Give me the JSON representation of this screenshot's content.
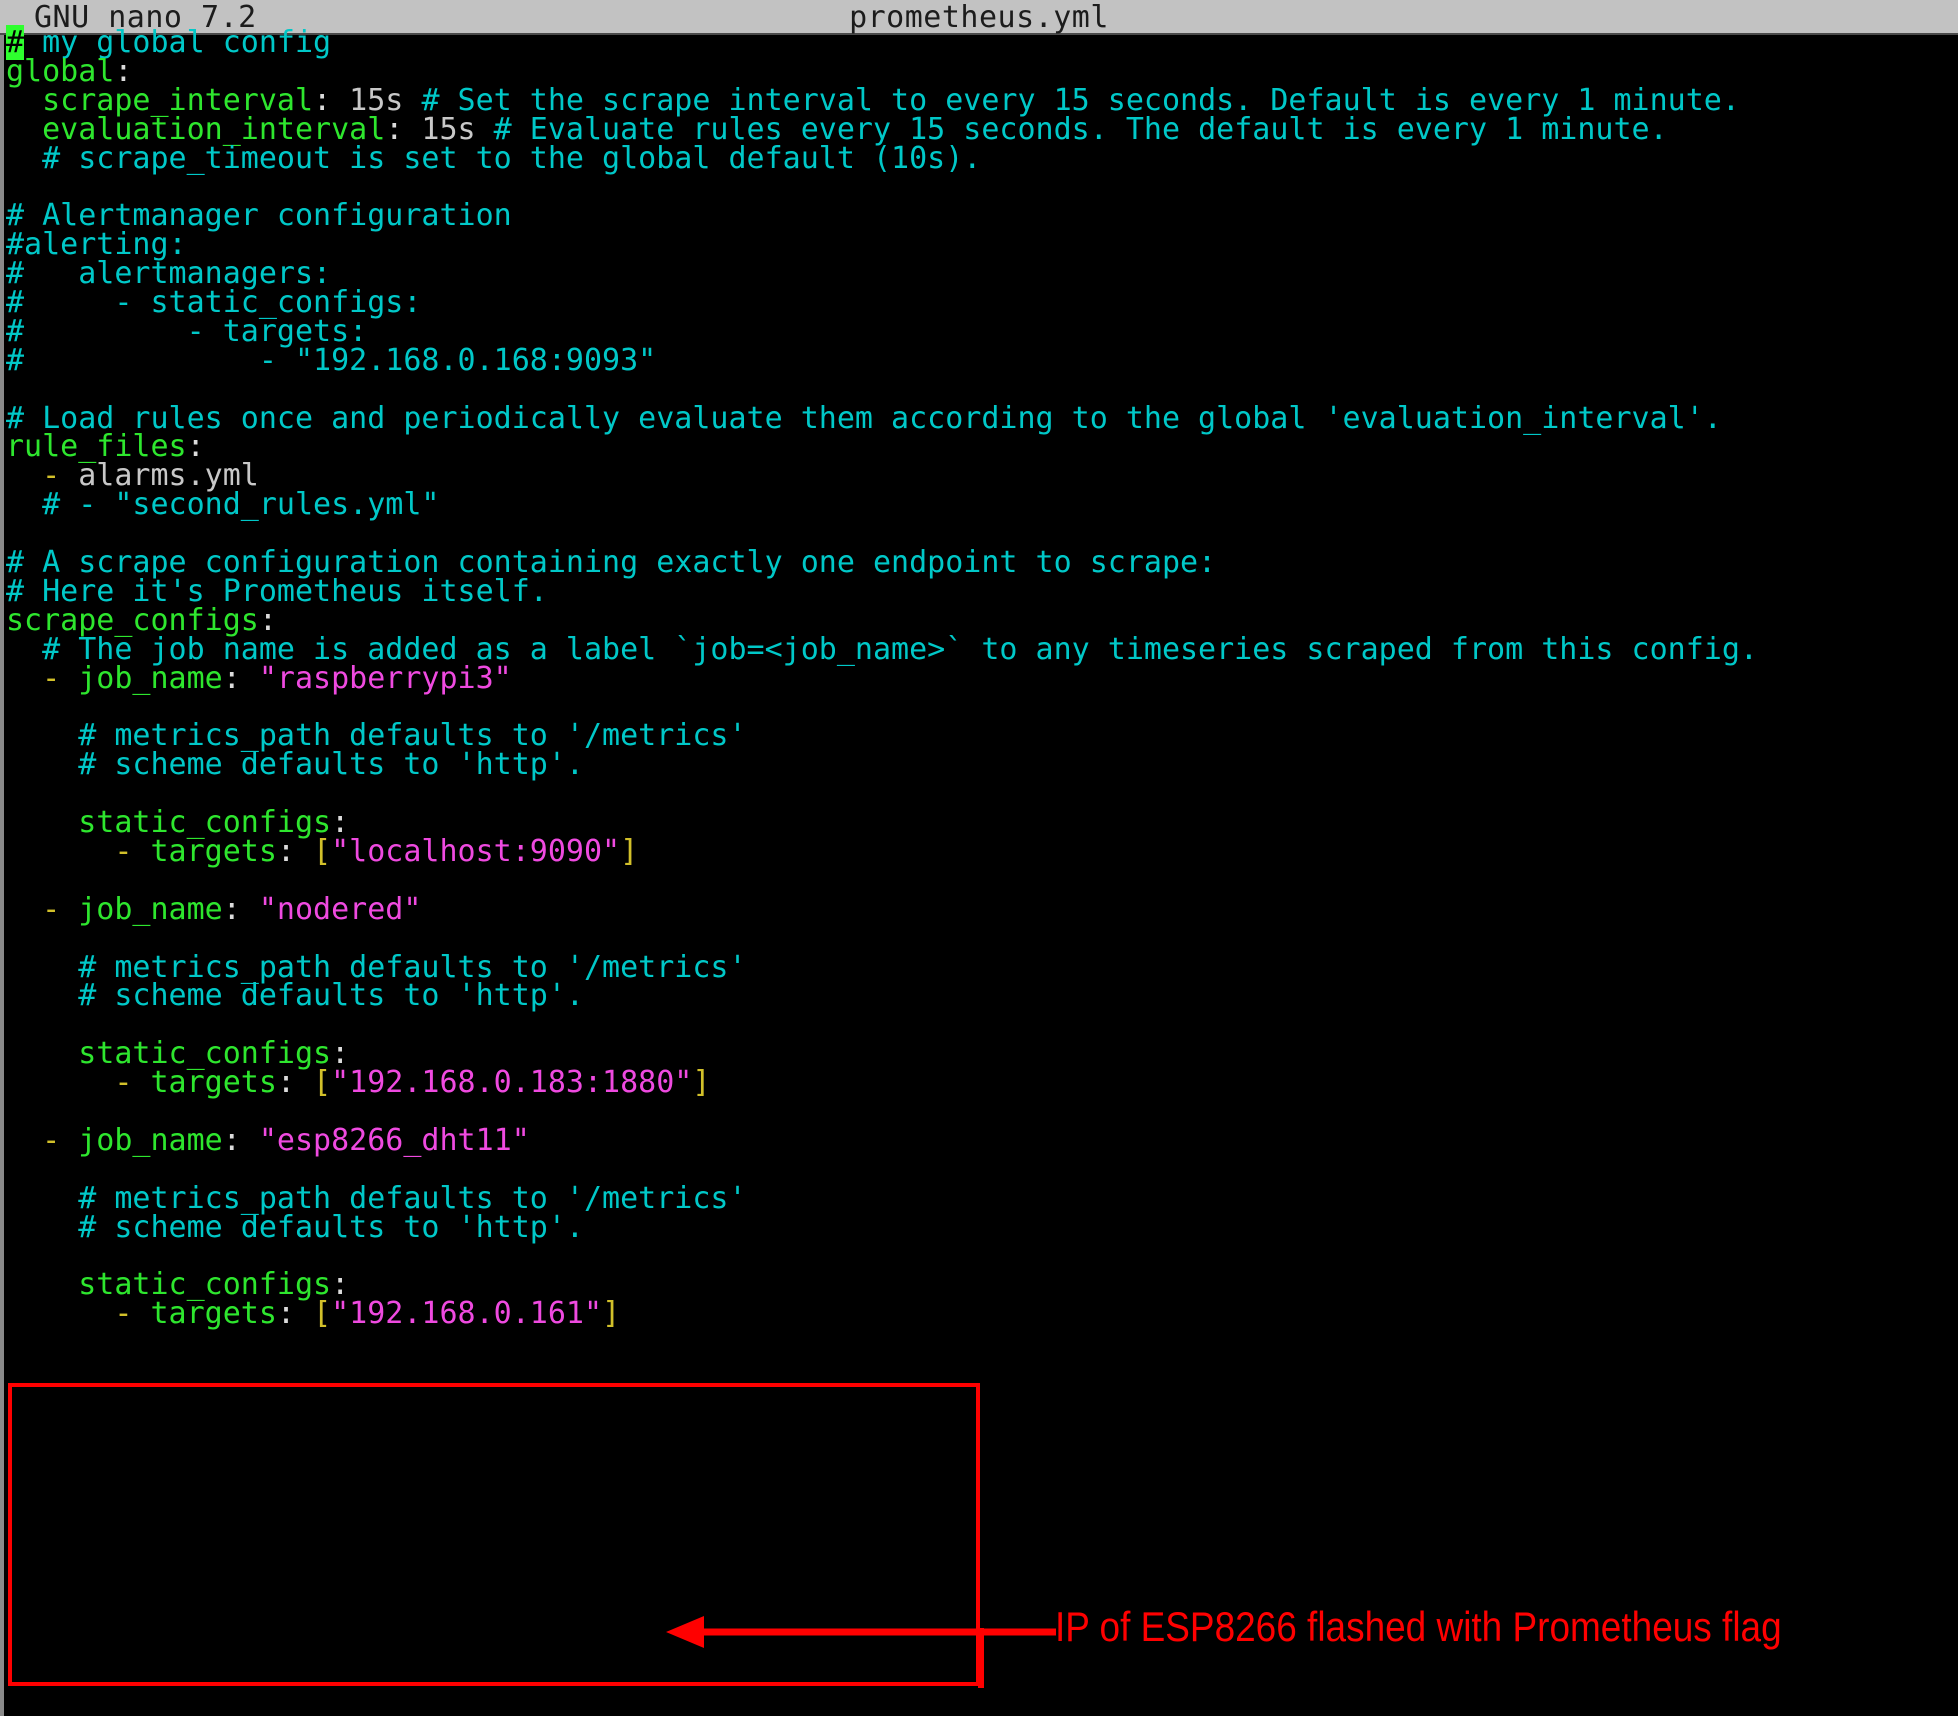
{
  "window": {
    "app_version": "GNU nano 7.2",
    "filename": "prometheus.yml"
  },
  "colors": {
    "titlebar_bg": "#c2c2c2",
    "editor_bg": "#000000",
    "comment": "#00c8c8",
    "key": "#2ee62e",
    "string": "#ef4ae0",
    "punct": "#dcdcdc",
    "dash": "#d2c02a",
    "cursor": "#2eff2e",
    "annotation": "#ff0000"
  },
  "editor": {
    "cursor_char": "#",
    "lines": [
      {
        "i": 0,
        "text": " my global config"
      },
      {
        "i": 1,
        "text": "global:"
      },
      {
        "i": 2,
        "text": "  scrape_interval: 15s # Set the scrape interval to every 15 seconds. Default is every 1 minute."
      },
      {
        "i": 3,
        "text": "  evaluation_interval: 15s # Evaluate rules every 15 seconds. The default is every 1 minute."
      },
      {
        "i": 4,
        "text": "  # scrape_timeout is set to the global default (10s)."
      },
      {
        "i": 5,
        "text": ""
      },
      {
        "i": 6,
        "text": "# Alertmanager configuration"
      },
      {
        "i": 7,
        "text": "#alerting:"
      },
      {
        "i": 8,
        "text": "#   alertmanagers:"
      },
      {
        "i": 9,
        "text": "#     - static_configs:"
      },
      {
        "i": 10,
        "text": "#         - targets:"
      },
      {
        "i": 11,
        "text": "#             - \"192.168.0.168:9093\""
      },
      {
        "i": 12,
        "text": ""
      },
      {
        "i": 13,
        "text": "# Load rules once and periodically evaluate them according to the global 'evaluation_interval'."
      },
      {
        "i": 14,
        "text": "rule_files:"
      },
      {
        "i": 15,
        "text": "  - alarms.yml"
      },
      {
        "i": 16,
        "text": "  # - \"second_rules.yml\""
      },
      {
        "i": 17,
        "text": ""
      },
      {
        "i": 18,
        "text": "# A scrape configuration containing exactly one endpoint to scrape:"
      },
      {
        "i": 19,
        "text": "# Here it's Prometheus itself."
      },
      {
        "i": 20,
        "text": "scrape_configs:"
      },
      {
        "i": 21,
        "text": "  # The job name is added as a label `job=<job_name>` to any timeseries scraped from this config."
      },
      {
        "i": 22,
        "text": "  - job_name: \"raspberrypi3\""
      },
      {
        "i": 23,
        "text": ""
      },
      {
        "i": 24,
        "text": "    # metrics_path defaults to '/metrics'"
      },
      {
        "i": 25,
        "text": "    # scheme defaults to 'http'."
      },
      {
        "i": 26,
        "text": ""
      },
      {
        "i": 27,
        "text": "    static_configs:"
      },
      {
        "i": 28,
        "text": "      - targets: [\"localhost:9090\"]"
      },
      {
        "i": 29,
        "text": ""
      },
      {
        "i": 30,
        "text": "  - job_name: \"nodered\""
      },
      {
        "i": 31,
        "text": ""
      },
      {
        "i": 32,
        "text": "    # metrics_path defaults to '/metrics'"
      },
      {
        "i": 33,
        "text": "    # scheme defaults to 'http'."
      },
      {
        "i": 34,
        "text": ""
      },
      {
        "i": 35,
        "text": "    static_configs:"
      },
      {
        "i": 36,
        "text": "      - targets: [\"192.168.0.183:1880\"]"
      },
      {
        "i": 37,
        "text": ""
      },
      {
        "i": 38,
        "text": "  - job_name: \"esp8266_dht11\""
      },
      {
        "i": 39,
        "text": ""
      },
      {
        "i": 40,
        "text": "    # metrics_path defaults to '/metrics'"
      },
      {
        "i": 41,
        "text": "    # scheme defaults to 'http'."
      },
      {
        "i": 42,
        "text": ""
      },
      {
        "i": 43,
        "text": "    static_configs:"
      },
      {
        "i": 44,
        "text": "      - targets: [\"192.168.0.161\"]"
      }
    ]
  },
  "annotation": {
    "label": "IP of ESP8266 flashed with Prometheus flag",
    "highlight_target": "- targets: [\"192.168.0.161\"]"
  }
}
